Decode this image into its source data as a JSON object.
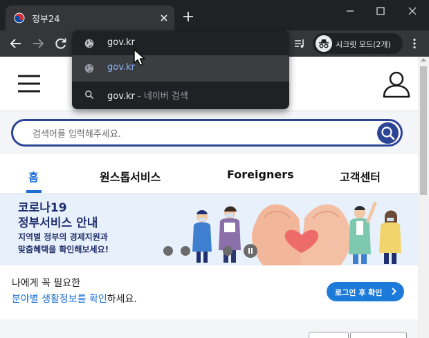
{
  "browser": {
    "tab_title": "정부24",
    "incognito_label": "시크릿 모드(2개)",
    "omnibox_value": "gov.kr"
  },
  "omnibox_dropdown": {
    "items": [
      {
        "text": "gov.kr",
        "icon": "globe-icon"
      },
      {
        "text": "gov.kr",
        "icon": "globe-icon",
        "highlighted": true
      },
      {
        "text": "gov.kr",
        "suffix": " - 네이버 검색",
        "icon": "search-icon"
      }
    ]
  },
  "site": {
    "search_placeholder": "검색어를 입력해주세요.",
    "nav_tabs": [
      "홈",
      "원스톱서비스",
      "Foreigners",
      "고객센터"
    ],
    "active_tab": "홈",
    "banner": {
      "title_line1": "코로나19",
      "title_line2": "정부서비스 안내",
      "sub_line1": "지역별 정부의 경제지원과",
      "sub_line2": "맞춤혜택을 확인해보세요!"
    },
    "need": {
      "line1": "나에게 꼭 필요한",
      "line2_highlight": "분야별 생활정보를 확인",
      "line2_rest": "하세요.",
      "login_button": "로그인 후 확인"
    }
  },
  "colors": {
    "brand_navy": "#2d4496",
    "accent_blue": "#1c6ed4",
    "chrome_dark": "#202124",
    "chrome_mid": "#35363a"
  }
}
